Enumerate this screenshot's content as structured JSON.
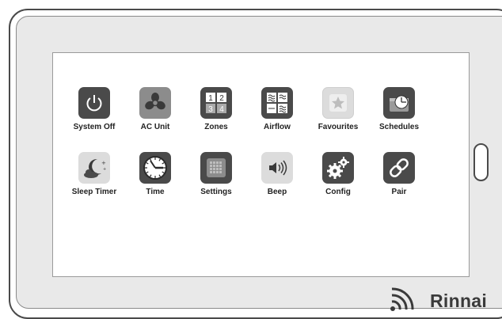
{
  "tiles_row1": [
    {
      "label": "System Off",
      "icon": "power-icon"
    },
    {
      "label": "AC Unit",
      "icon": "fan-icon"
    },
    {
      "label": "Zones",
      "icon": "zones-grid-icon",
      "digits": [
        "1",
        "2",
        "3",
        "4"
      ]
    },
    {
      "label": "Airflow",
      "icon": "airflow-icon"
    },
    {
      "label": "Favourites",
      "icon": "star-icon"
    },
    {
      "label": "Schedules",
      "icon": "calendar-clock-icon"
    }
  ],
  "tiles_row2": [
    {
      "label": "Sleep Timer",
      "icon": "moon-cloud-icon"
    },
    {
      "label": "Time",
      "icon": "clock-icon"
    },
    {
      "label": "Settings",
      "icon": "keypad-icon"
    },
    {
      "label": "Beep",
      "icon": "speaker-icon"
    },
    {
      "label": "Config",
      "icon": "gears-icon"
    },
    {
      "label": "Pair",
      "icon": "link-icon"
    }
  ],
  "brand": {
    "name": "Rinnai",
    "icon": "wifi-signal-icon"
  },
  "colors": {
    "dark": "#4a4a4a",
    "mid": "#8c8c8c",
    "light": "#dcdcdc"
  }
}
